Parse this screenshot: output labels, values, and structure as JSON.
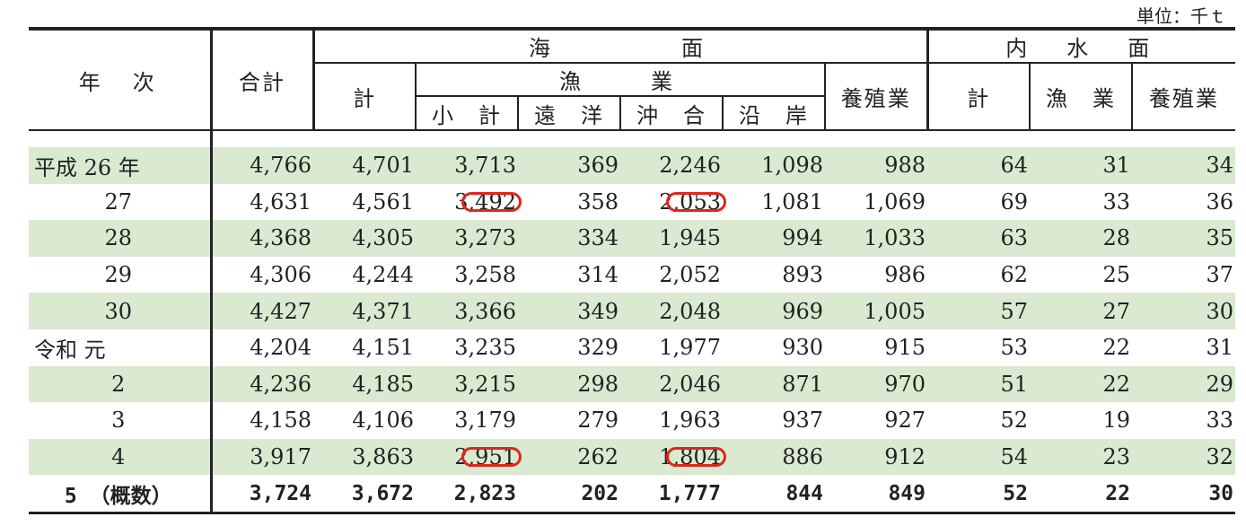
{
  "unit": "単位：千ｔ",
  "header": {
    "year": "年　次",
    "total": "合計",
    "sea": "海　　　　面",
    "sea_total": "計",
    "fishery": "漁　　業",
    "subtotal": "小　計",
    "distant": "遠　洋",
    "offshore": "沖　合",
    "coastal": "沿　岸",
    "aquaculture": "養殖業",
    "inland": "内　水　面",
    "inland_total": "計",
    "inland_fishery": "漁　業",
    "inland_aquaculture": "養殖業"
  },
  "rows": [
    {
      "year": "平成 26 年",
      "cells": [
        "4,766",
        "4,701",
        "3,713",
        "369",
        "2,246",
        "1,098",
        "988",
        "64",
        "31",
        "34"
      ]
    },
    {
      "year": "27",
      "cells": [
        "4,631",
        "4,561",
        "3,492",
        "358",
        "2,053",
        "1,081",
        "1,069",
        "69",
        "33",
        "36"
      ]
    },
    {
      "year": "28",
      "cells": [
        "4,368",
        "4,305",
        "3,273",
        "334",
        "1,945",
        "994",
        "1,033",
        "63",
        "28",
        "35"
      ]
    },
    {
      "year": "29",
      "cells": [
        "4,306",
        "4,244",
        "3,258",
        "314",
        "2,052",
        "893",
        "986",
        "62",
        "25",
        "37"
      ]
    },
    {
      "year": "30",
      "cells": [
        "4,427",
        "4,371",
        "3,366",
        "349",
        "2,048",
        "969",
        "1,005",
        "57",
        "27",
        "30"
      ]
    },
    {
      "year": "令和 元",
      "cells": [
        "4,204",
        "4,151",
        "3,235",
        "329",
        "1,977",
        "930",
        "915",
        "53",
        "22",
        "31"
      ]
    },
    {
      "year": "2",
      "cells": [
        "4,236",
        "4,185",
        "3,215",
        "298",
        "2,046",
        "871",
        "970",
        "51",
        "22",
        "29"
      ]
    },
    {
      "year": "3",
      "cells": [
        "4,158",
        "4,106",
        "3,179",
        "279",
        "1,963",
        "937",
        "927",
        "52",
        "19",
        "33"
      ]
    },
    {
      "year": "4",
      "cells": [
        "3,917",
        "3,863",
        "2,951",
        "262",
        "1,804",
        "886",
        "912",
        "54",
        "23",
        "32"
      ]
    },
    {
      "year": "5 （概数）",
      "cells": [
        "3,724",
        "3,672",
        "2,823",
        "202",
        "1,777",
        "844",
        "849",
        "52",
        "22",
        "30"
      ]
    }
  ],
  "highlight_color": "#e1251b",
  "stripe_color": "#d9ead0"
}
